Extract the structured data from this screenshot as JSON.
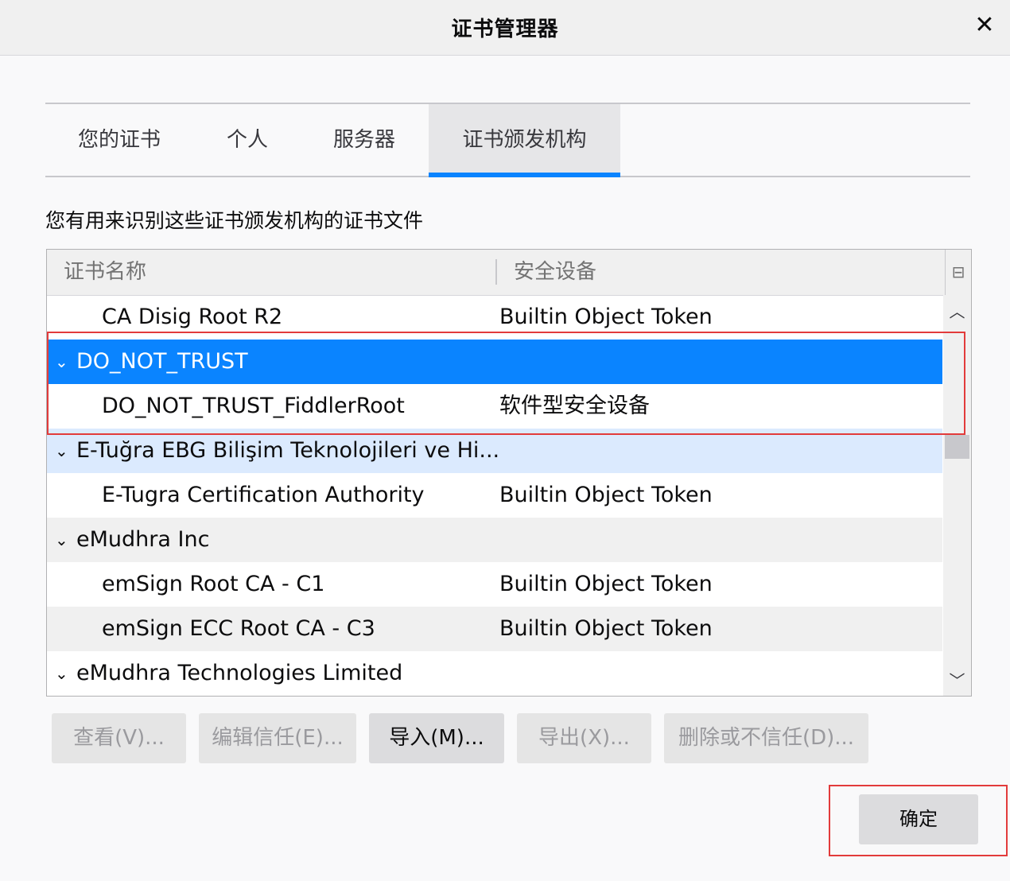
{
  "window": {
    "title": "证书管理器",
    "close_glyph": "✕"
  },
  "tabs": [
    {
      "label": "您的证书",
      "active": false
    },
    {
      "label": "个人",
      "active": false
    },
    {
      "label": "服务器",
      "active": false
    },
    {
      "label": "证书颁发机构",
      "active": true
    }
  ],
  "description": "您有用来识别这些证书颁发机构的证书文件",
  "tree": {
    "columns": {
      "name": "证书名称",
      "device": "安全设备"
    },
    "column_picker_glyph": "⊟",
    "rows": [
      {
        "type": "cert",
        "name": "CA Disig Root R2",
        "device": "Builtin Object Token",
        "state": "normal"
      },
      {
        "type": "group",
        "name": "DO_NOT_TRUST",
        "device": "",
        "state": "selected"
      },
      {
        "type": "cert",
        "name": "DO_NOT_TRUST_FiddlerRoot",
        "device": "软件型安全设备",
        "state": "normal"
      },
      {
        "type": "group",
        "name": "E-Tuğra EBG Bilişim Teknolojileri ve Hi...",
        "device": "",
        "state": "hover"
      },
      {
        "type": "cert",
        "name": "E-Tugra Certification Authority",
        "device": "Builtin Object Token",
        "state": "normal"
      },
      {
        "type": "group",
        "name": "eMudhra Inc",
        "device": "",
        "state": "alt"
      },
      {
        "type": "cert",
        "name": "emSign Root CA - C1",
        "device": "Builtin Object Token",
        "state": "normal"
      },
      {
        "type": "cert",
        "name": "emSign ECC Root CA - C3",
        "device": "Builtin Object Token",
        "state": "alt"
      },
      {
        "type": "group",
        "name": "eMudhra Technologies Limited",
        "device": "",
        "state": "normal"
      }
    ],
    "twisty_glyph": "⌄",
    "scroll_up_glyph": "︿",
    "scroll_down_glyph": "﹀"
  },
  "buttons": {
    "view": "查看(V)...",
    "edit_trust": "编辑信任(E)...",
    "import": "导入(M)...",
    "export": "导出(X)...",
    "delete_distrust": "删除或不信任(D)...",
    "ok": "确定"
  },
  "colors": {
    "selected_bg": "#0a84ff",
    "hover_bg": "#dbeafe",
    "alt_bg": "#f0f0f0",
    "highlight_box": "#e23b3b"
  }
}
